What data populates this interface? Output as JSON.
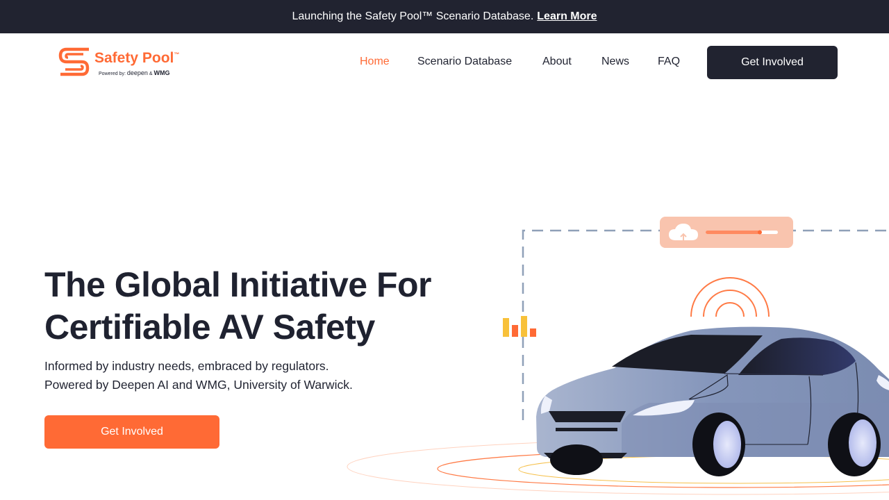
{
  "announcement": {
    "text": "Launching the Safety Pool™ Scenario Database.",
    "link": "Learn More"
  },
  "brand": {
    "name": "Safety Pool",
    "trademark": "™",
    "powered_by": "Powered by:",
    "partner_1": "deepen",
    "ampersand": "&",
    "partner_2": "WMG",
    "color": "#ff6a35"
  },
  "nav": {
    "items": [
      {
        "label": "Home",
        "active": true
      },
      {
        "label": "Scenario Database",
        "active": false
      },
      {
        "label": "About",
        "active": false
      },
      {
        "label": "News",
        "active": false
      },
      {
        "label": "FAQ",
        "active": false
      }
    ],
    "cta": "Get Involved"
  },
  "hero": {
    "title_line_1": "The Global Initiative For",
    "title_line_2": "Certifiable AV Safety",
    "subtitle_line_1": "Informed by industry needs, embraced by regulators.",
    "subtitle_line_2": "Powered by Deepen AI and WMG, University of Warwick.",
    "cta": "Get Involved"
  },
  "illustration": {
    "icons": [
      "cloud-upload-icon",
      "signal-waves-icon",
      "bar-chart-icon",
      "car-illustration"
    ],
    "upload_progress": 0.75,
    "colors": {
      "accent": "#ff6a35",
      "dark": "#212330",
      "car": "#7e8fb3"
    }
  }
}
